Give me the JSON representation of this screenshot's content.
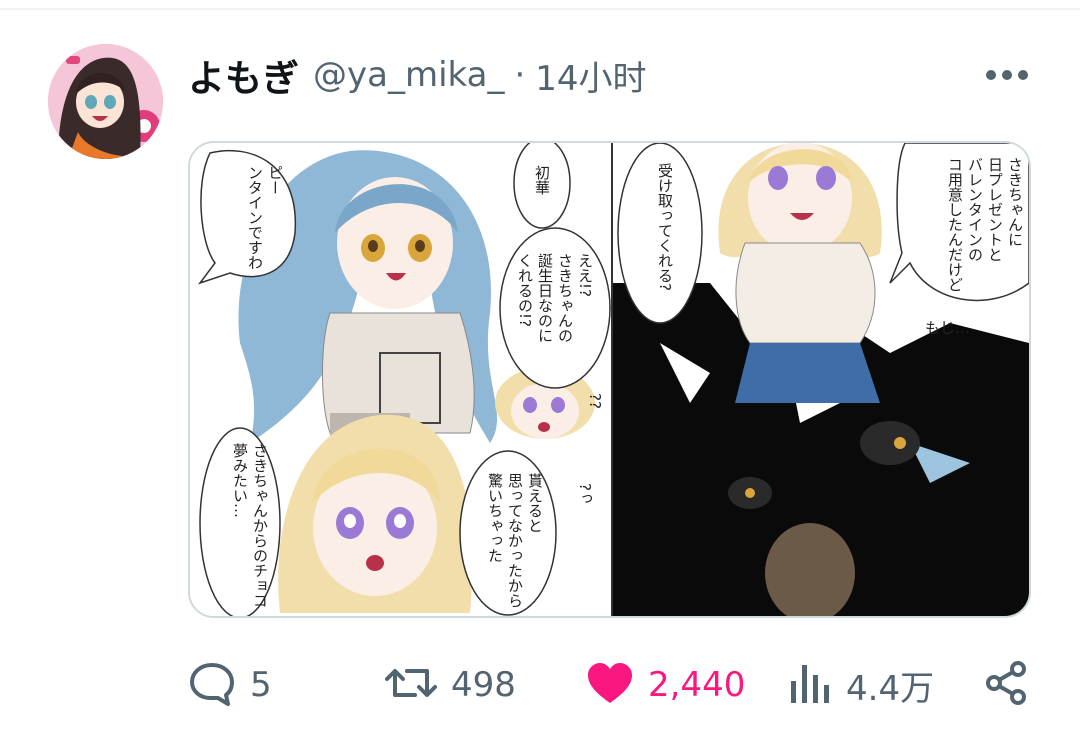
{
  "tweet": {
    "display_name": "よもぎ",
    "handle": "@ya_mika_",
    "separator": "·",
    "time": "14小时",
    "avatar_icon": "user-avatar",
    "more_icon": "more-dots-icon"
  },
  "media": {
    "panels": [
      {
        "text": "ピー\nンタインですわ"
      },
      {
        "text": "初華"
      },
      {
        "text": "ええ!?\nさきちゃんの\n誕生日なのに\nくれるの!?"
      },
      {
        "text": "さきちゃんからのチョコ\n夢みたい…"
      },
      {
        "text": "貰えると\n思ってなかったから\n驚いちゃった"
      },
      {
        "text": "受け取ってくれる?"
      },
      {
        "text": "さきちゃんに\n日プレゼントと\nバレンタインの\nコ用意したんだけど"
      },
      {
        "text": "もじ…"
      },
      {
        "text": "??"
      },
      {
        "text": "?っ"
      }
    ]
  },
  "actions": {
    "reply": {
      "icon": "reply-bubble-icon",
      "count": "5"
    },
    "retweet": {
      "icon": "retweet-icon",
      "count": "498"
    },
    "like": {
      "icon": "heart-icon",
      "count": "2,440",
      "color": "#f91880"
    },
    "views": {
      "icon": "bar-chart-icon",
      "count": "4.4万"
    },
    "share": {
      "icon": "share-icon"
    }
  },
  "colors": {
    "secondary_text": "#536471",
    "primary_text": "#0f1419",
    "like": "#f91880",
    "border": "#cfd9de"
  }
}
